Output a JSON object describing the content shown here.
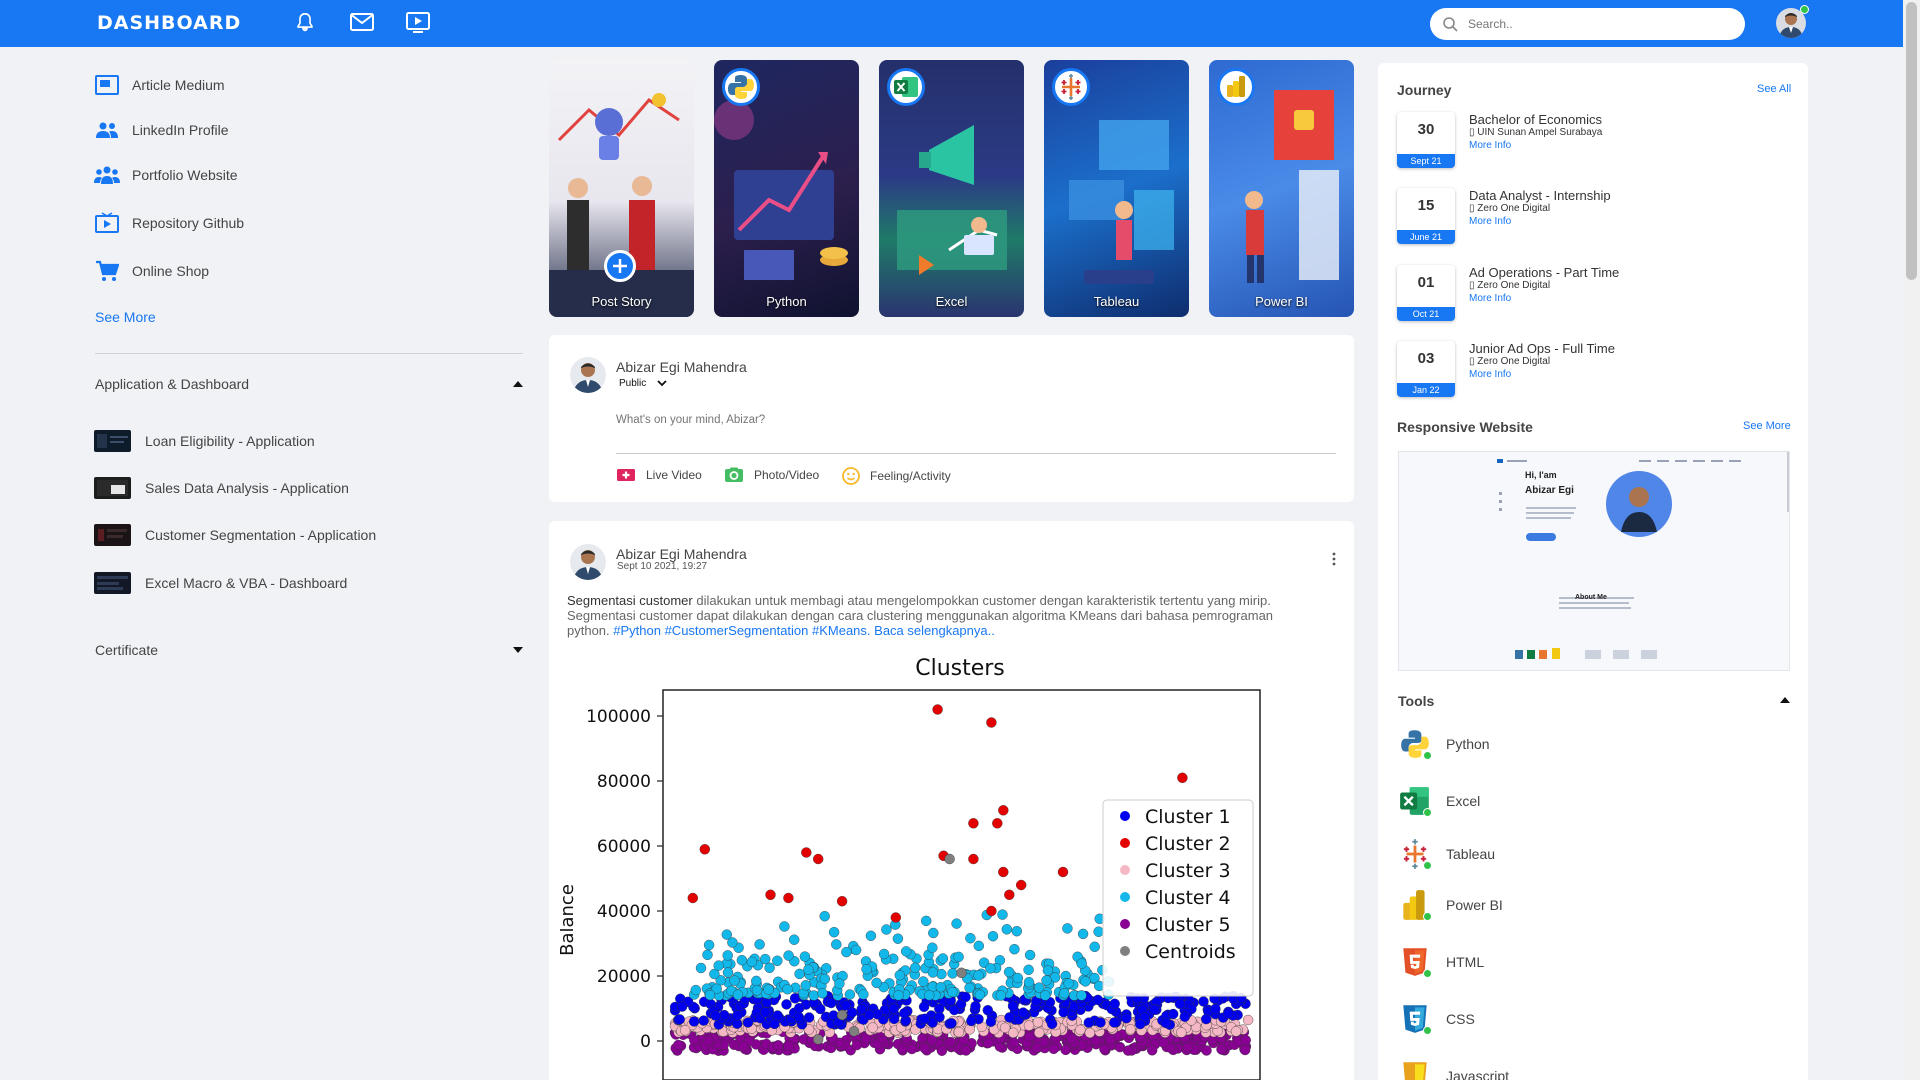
{
  "app": {
    "logo": "DASHBOARD"
  },
  "topbar": {
    "search_placeholder": "Search.."
  },
  "sidebar": {
    "links": [
      {
        "label": "Article Medium",
        "icon": "article-icon"
      },
      {
        "label": "LinkedIn Profile",
        "icon": "people-icon"
      },
      {
        "label": "Portfolio Website",
        "icon": "group-icon"
      },
      {
        "label": "Repository Github",
        "icon": "tv-play-icon"
      },
      {
        "label": "Online Shop",
        "icon": "cart-icon"
      }
    ],
    "see_more": "See More",
    "apps_section": "Application & Dashboard",
    "apps": [
      "Loan Eligibility - Application",
      "Sales Data Analysis - Application",
      "Customer Segmentation - Application",
      "Excel Macro & VBA - Dashboard"
    ],
    "certificate_section": "Certificate"
  },
  "stories": [
    {
      "label": "Post Story",
      "icon": "plus-circle-icon"
    },
    {
      "label": "Python",
      "icon": "python-icon"
    },
    {
      "label": "Excel",
      "icon": "excel-icon"
    },
    {
      "label": "Tableau",
      "icon": "tableau-icon"
    },
    {
      "label": "Power BI",
      "icon": "powerbi-icon"
    }
  ],
  "composer": {
    "name": "Abizar Egi Mahendra",
    "audience": "Public",
    "placeholder": "What's on your mind, Abizar?",
    "actions": [
      "Live Video",
      "Photo/Video",
      "Feeling/Activity"
    ]
  },
  "post": {
    "name": "Abizar Egi Mahendra",
    "timestamp": "Sept 10 2021, 19:27",
    "text_strong": "Segmentasi customer",
    "text_body": " dilakukan untuk membagi atau mengelompokkan customer dengan karakteristik tertentu yang mirip. Segmentasi customer dapat dilakukan dengan cara clustering menggunakan algoritma KMeans dari bahasa pemrograman python. ",
    "hashtags": "#Python #CustomerSegmentation #KMeans.",
    "read_more": "Baca selengkapnya..",
    "chart": {
      "title": "Clusters",
      "ylabel": "Balance",
      "yticks": [
        "100000",
        "80000",
        "60000",
        "40000",
        "20000",
        "0"
      ],
      "legend": [
        "Cluster 1",
        "Cluster 2",
        "Cluster 3",
        "Cluster 4",
        "Cluster 5",
        "Centroids"
      ],
      "colors": [
        "#0000ee",
        "#e30000",
        "#f4b8c4",
        "#12b8ea",
        "#8a0094",
        "#7f7f7f"
      ]
    }
  },
  "chart_data": {
    "type": "scatter",
    "title": "Clusters",
    "ylabel": "Balance",
    "ylim": [
      -12000,
      108000
    ],
    "yticks": [
      0,
      20000,
      40000,
      60000,
      80000,
      100000
    ],
    "legend_position": "center-right",
    "series": [
      {
        "name": "Cluster 1",
        "color": "#0000ee",
        "y_range": [
          5000,
          14000
        ]
      },
      {
        "name": "Cluster 2",
        "color": "#e30000",
        "points": [
          [
            0.46,
            102000
          ],
          [
            0.55,
            98000
          ],
          [
            0.87,
            81000
          ],
          [
            0.57,
            71000
          ],
          [
            0.52,
            67000
          ],
          [
            0.56,
            67000
          ],
          [
            0.07,
            59000
          ],
          [
            0.24,
            58000
          ],
          [
            0.26,
            56000
          ],
          [
            0.52,
            56000
          ],
          [
            0.47,
            57000
          ],
          [
            0.57,
            52000
          ],
          [
            0.67,
            52000
          ],
          [
            0.05,
            44000
          ],
          [
            0.18,
            45000
          ],
          [
            0.21,
            44000
          ],
          [
            0.3,
            43000
          ],
          [
            0.39,
            38000
          ],
          [
            0.58,
            45000
          ],
          [
            0.6,
            48000
          ],
          [
            0.55,
            40000
          ]
        ]
      },
      {
        "name": "Cluster 3",
        "color": "#f4b8c4",
        "y_range": [
          2500,
          6500
        ]
      },
      {
        "name": "Cluster 4",
        "color": "#12b8ea",
        "y_range": [
          14000,
          40000
        ]
      },
      {
        "name": "Cluster 5",
        "color": "#8a0094",
        "y_range": [
          -3000,
          3000
        ]
      },
      {
        "name": "Centroids",
        "color": "#7f7f7f",
        "points": [
          [
            0.48,
            56000
          ],
          [
            0.3,
            8000
          ],
          [
            0.32,
            3000
          ],
          [
            0.5,
            21000
          ],
          [
            0.26,
            500
          ]
        ]
      }
    ]
  },
  "right": {
    "journey_title": "Journey",
    "journey_link": "See All",
    "journey": [
      {
        "day": "30",
        "mon": "Sept 21",
        "title": "Bachelor of Economics",
        "org": "UIN Sunan Ampel Surabaya",
        "more": "More Info"
      },
      {
        "day": "15",
        "mon": "June 21",
        "title": "Data Analyst - Internship",
        "org": "Zero One Digital",
        "more": "More Info"
      },
      {
        "day": "01",
        "mon": "Oct 21",
        "title": "Ad Operations - Part Time",
        "org": "Zero One Digital",
        "more": "More Info"
      },
      {
        "day": "03",
        "mon": "Jan 22",
        "title": "Junior Ad Ops - Full Time",
        "org": "Zero One Digital",
        "more": "More Info"
      }
    ],
    "website_title": "Responsive Website",
    "website_link": "See More",
    "website_preview": {
      "greeting": "Hi, I'am",
      "name": "Abizar Egi",
      "about": "About Me"
    },
    "tools_title": "Tools",
    "tools": [
      {
        "label": "Python",
        "icon": "python-icon"
      },
      {
        "label": "Excel",
        "icon": "excel-icon"
      },
      {
        "label": "Tableau",
        "icon": "tableau-icon"
      },
      {
        "label": "Power BI",
        "icon": "powerbi-icon"
      },
      {
        "label": "HTML",
        "icon": "html5-icon"
      },
      {
        "label": "CSS",
        "icon": "css3-icon"
      },
      {
        "label": "Javascript",
        "icon": "javascript-icon"
      }
    ]
  }
}
